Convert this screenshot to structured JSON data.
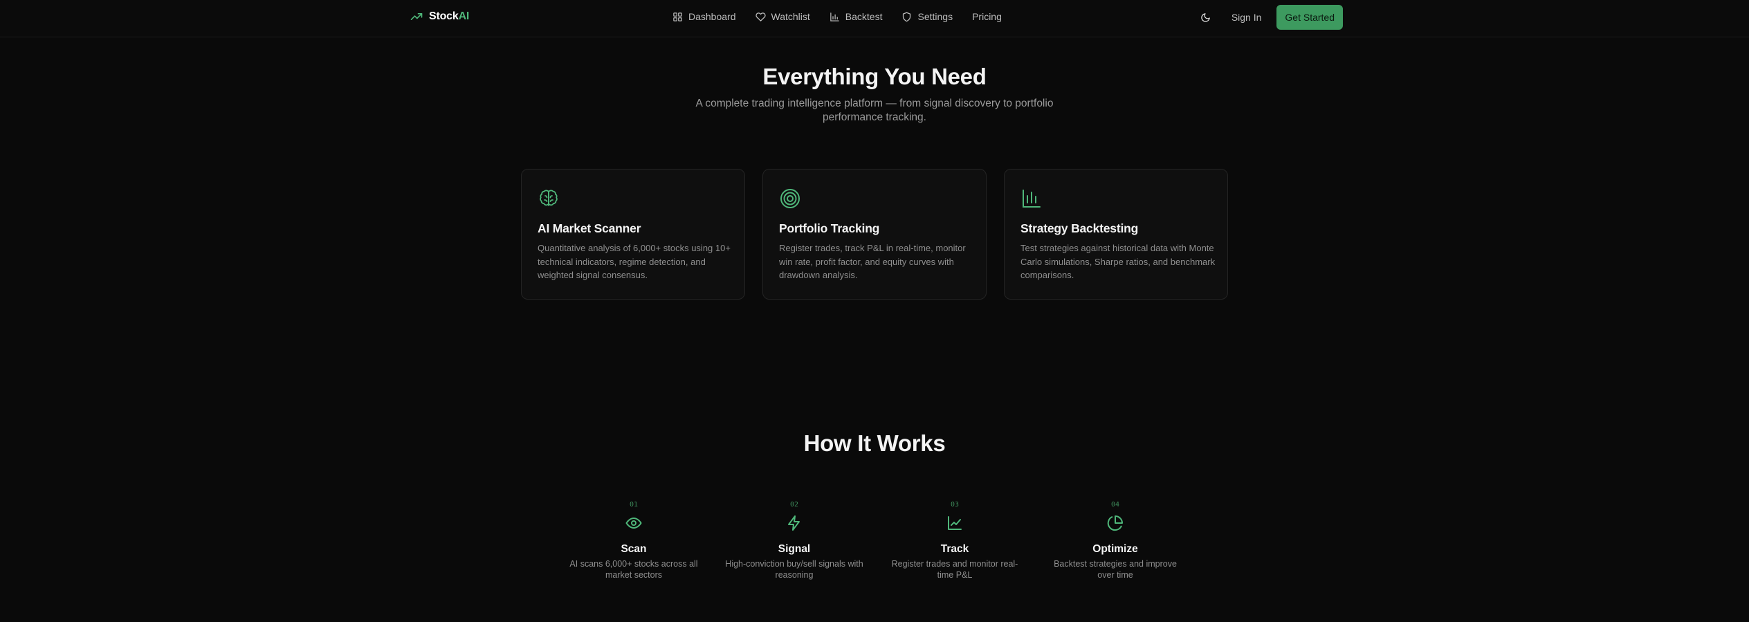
{
  "nav": {
    "brand_prefix": "Stock",
    "brand_suffix": "AI",
    "links": [
      {
        "label": "Dashboard",
        "icon": "grid-icon"
      },
      {
        "label": "Watchlist",
        "icon": "heart-icon"
      },
      {
        "label": "Backtest",
        "icon": "bar-chart-icon"
      },
      {
        "label": "Settings",
        "icon": "shield-icon"
      },
      {
        "label": "Pricing",
        "icon": ""
      }
    ],
    "theme_icon": "moon-icon",
    "signin_label": "Sign In",
    "cta_label": "Get Started"
  },
  "features": {
    "title": "Everything You Need",
    "subtitle": "A complete trading intelligence platform — from signal discovery to portfolio performance tracking.",
    "cards": [
      {
        "icon": "brain-icon",
        "title": "AI Market Scanner",
        "description": "Quantitative analysis of 6,000+ stocks using 10+ technical indicators, regime detection, and weighted signal consensus."
      },
      {
        "icon": "target-icon",
        "title": "Portfolio Tracking",
        "description": "Register trades, track P&L in real-time, monitor win rate, profit factor, and equity curves with drawdown analysis."
      },
      {
        "icon": "bar-chart-icon",
        "title": "Strategy Backtesting",
        "description": "Test strategies against historical data with Monte Carlo simulations, Sharpe ratios, and benchmark comparisons."
      }
    ]
  },
  "how": {
    "title": "How It Works",
    "steps": [
      {
        "num": "01",
        "icon": "eye-icon",
        "title": "Scan",
        "description": "AI scans 6,000+ stocks across all market sectors"
      },
      {
        "num": "02",
        "icon": "lightning-icon",
        "title": "Signal",
        "description": "High-conviction buy/sell signals with reasoning"
      },
      {
        "num": "03",
        "icon": "line-chart-icon",
        "title": "Track",
        "description": "Register trades and monitor real-time P&L"
      },
      {
        "num": "04",
        "icon": "pie-chart-icon",
        "title": "Optimize",
        "description": "Backtest strategies and improve over time"
      }
    ]
  },
  "colors": {
    "background": "#0a0a0a",
    "accent": "#3d9a5f",
    "muted_text": "#8f8f8f"
  }
}
